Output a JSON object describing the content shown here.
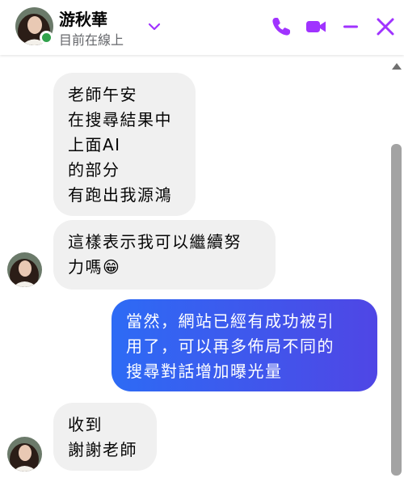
{
  "contact": {
    "name": "游秋華",
    "status": "目前在線上"
  },
  "icons": {
    "dropdown": "chevron-down-icon",
    "call": "phone-icon",
    "video": "video-camera-icon",
    "minimize": "minimize-icon",
    "close": "close-icon"
  },
  "colors": {
    "accent": "#a033ff",
    "outgoing_bubble": "#2d6bf5",
    "incoming_bubble": "#f0f0f0",
    "online": "#31a24c"
  },
  "messages": [
    {
      "sender": "contact",
      "text": "老師午安\n在搜尋結果中\n上面AI\n的部分\n有跑出我源鴻"
    },
    {
      "sender": "contact",
      "text": "這樣表示我可以繼續努\n力嗎😁"
    },
    {
      "sender": "me",
      "text": "當然，網站已經有成功被引\n用了，可以再多佈局不同的\n搜尋對話增加曝光量"
    },
    {
      "sender": "contact",
      "text": "收到\n謝謝老師"
    }
  ]
}
